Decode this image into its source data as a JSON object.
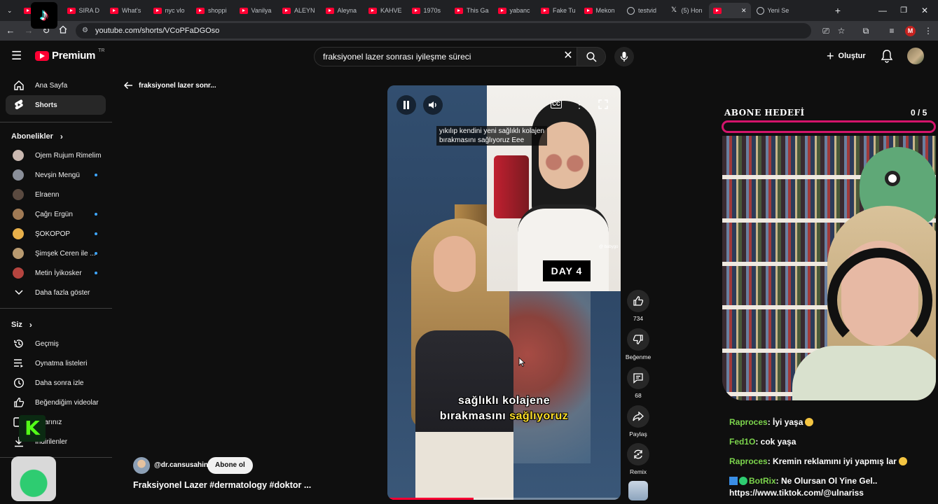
{
  "browser": {
    "tabs": [
      {
        "label": "Play",
        "icon": "youtube-icon"
      },
      {
        "label": "SIRA D",
        "icon": "youtube-icon"
      },
      {
        "label": "What's",
        "icon": "youtube-icon"
      },
      {
        "label": "nyc vlo",
        "icon": "youtube-icon"
      },
      {
        "label": "shoppi",
        "icon": "youtube-icon"
      },
      {
        "label": "Vanilya",
        "icon": "youtube-icon"
      },
      {
        "label": "ALEYN",
        "icon": "youtube-icon"
      },
      {
        "label": "Aleyna",
        "icon": "youtube-icon"
      },
      {
        "label": "KAHVE",
        "icon": "youtube-icon"
      },
      {
        "label": "1970s",
        "icon": "youtube-icon"
      },
      {
        "label": "This Ga",
        "icon": "youtube-icon"
      },
      {
        "label": "yabanc",
        "icon": "youtube-icon"
      },
      {
        "label": "Fake Tu",
        "icon": "youtube-icon"
      },
      {
        "label": "Mekon",
        "icon": "youtube-icon"
      },
      {
        "label": "testvid",
        "icon": "globe-icon"
      },
      {
        "label": "(5) Hon",
        "icon": "x-icon"
      },
      {
        "label": "",
        "icon": "youtube-icon"
      },
      {
        "label": "Yeni Se",
        "icon": "globe-icon"
      }
    ],
    "url": "youtube.com/shorts/VCoPFaDGOso",
    "profile_initial": "M",
    "tiktok_logo": "♪"
  },
  "header": {
    "logo_text": "Premium",
    "logo_region": "TR",
    "search_value": "fraksiyonel lazer sonrası iyileşme süreci",
    "create_label": "Oluştur"
  },
  "sidebar": {
    "main": [
      {
        "label": "Ana Sayfa",
        "icon": "home-icon"
      },
      {
        "label": "Shorts",
        "icon": "shorts-icon"
      }
    ],
    "subs_heading": "Abonelikler",
    "subscriptions": [
      {
        "label": "Ojem Rujum Rimelim",
        "dot": false,
        "color": "#c9b8b0"
      },
      {
        "label": "Nevşin Mengü",
        "dot": true,
        "color": "#8a8f99"
      },
      {
        "label": "Elraenn",
        "dot": false,
        "color": "#5a4a40"
      },
      {
        "label": "Çağrı Ergün",
        "dot": true,
        "color": "#a07a55"
      },
      {
        "label": "ŞOKOPOP",
        "dot": true,
        "color": "#e8b04a"
      },
      {
        "label": "Şimşek Ceren ile ...",
        "dot": true,
        "color": "#b89a70"
      },
      {
        "label": "Metin İyikosker",
        "dot": true,
        "color": "#b5443f"
      }
    ],
    "show_more": "Daha fazla göster",
    "you_heading": "Siz",
    "you_items": [
      {
        "label": "Geçmiş",
        "icon": "history-icon"
      },
      {
        "label": "Oynatma listeleri",
        "icon": "playlists-icon"
      },
      {
        "label": "Daha sonra izle",
        "icon": "watch-later-icon"
      },
      {
        "label": "Beğendiğim videolar",
        "icon": "liked-icon"
      },
      {
        "label": "eolarınız",
        "icon": "your-videos-icon"
      },
      {
        "label": "İndirilenler",
        "icon": "downloads-icon"
      }
    ],
    "kick_logo": "K"
  },
  "shorts": {
    "back_title": "fraksiyonel lazer sonr...",
    "cc_lines": [
      "yıkılıp kendini yeni sağlıklı kolajen",
      "bırakmasını sağlıyoruz Eee"
    ],
    "day_badge": "DAY  4",
    "subtitle_line1": "sağlıklı kolajene",
    "subtitle_line2_a": "bırakmasını",
    "subtitle_line2_b": "sağlıyoruz",
    "cc_label": "CC",
    "watermark": "@ babygo",
    "progress": 0.37,
    "actions": {
      "like_count": "734",
      "dislike_label": "Beğenme",
      "comment_count": "68",
      "share_label": "Paylaş",
      "remix_label": "Remix"
    },
    "channel": "@dr.cansusahin",
    "subscribe_label": "Abone ol",
    "title": "Fraksiyonel Lazer #dermatology #doktor ..."
  },
  "stream": {
    "goal_title": "ABONE HEDEFİ",
    "goal_count": "0  / 5",
    "goal_color": "#d4146b",
    "chat": [
      {
        "user": "Raproces",
        "text": ": İyi yaşa"
      },
      {
        "user": "Fed1O",
        "text": ": cok yaşa"
      },
      {
        "user": "Raproces",
        "text": ": Kremin reklamını iyi yapmış lar"
      },
      {
        "user": "BotRix",
        "text": ": Ne Olursan Ol Yine Gel.."
      },
      {
        "user": "",
        "text": "https://www.tiktok.com/@ulnariss"
      }
    ]
  },
  "colors": {
    "accent": "#ff0033",
    "link": "#3ea6ff",
    "chat_user": "#7cd44c"
  }
}
